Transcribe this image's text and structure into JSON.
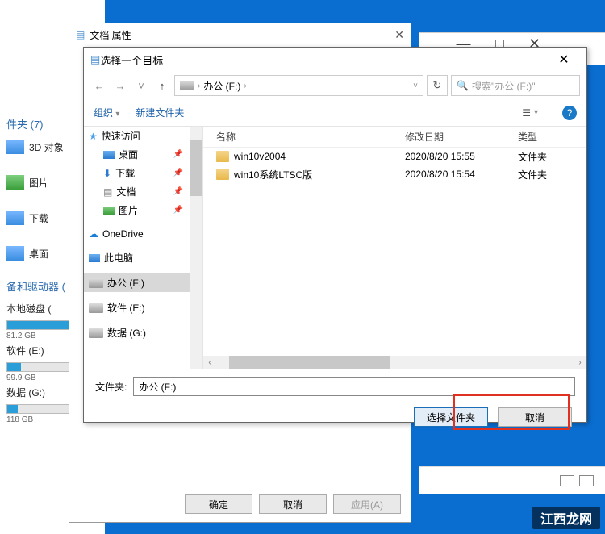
{
  "bg_explorer": {
    "section1": "件夹 (7)",
    "items1": [
      {
        "label": "3D 对象"
      },
      {
        "label": "图片"
      },
      {
        "label": "下载"
      },
      {
        "label": "桌面"
      }
    ],
    "section2": "备和驱动器 (",
    "drives": [
      {
        "label": "本地磁盘 (",
        "cap": "81.2 GB",
        "pct": "90%"
      },
      {
        "label": "软件 (E:)",
        "cap": "99.9 GB",
        "pct": "20%"
      },
      {
        "label": "数据 (G:)",
        "cap": "118 GB",
        "pct": "15%"
      }
    ]
  },
  "bg_window": {
    "min": "—",
    "max": "□",
    "close": "✕"
  },
  "props": {
    "title": "文档 属性",
    "ok": "确定",
    "cancel": "取消",
    "apply": "应用(A)"
  },
  "picker": {
    "title": "选择一个目标",
    "breadcrumb": "办公 (F:)",
    "search_placeholder": "搜索\"办公 (F:)\"",
    "organize": "组织",
    "new_folder": "新建文件夹",
    "columns": {
      "name": "名称",
      "date": "修改日期",
      "type": "类型"
    },
    "nav": {
      "quick": "快速访问",
      "desktop": "桌面",
      "downloads": "下载",
      "documents": "文档",
      "pictures": "图片",
      "onedrive": "OneDrive",
      "thispc": "此电脑",
      "drive_f": "办公 (F:)",
      "drive_e": "软件 (E:)",
      "drive_g": "数据 (G:)"
    },
    "files": [
      {
        "name": "win10v2004",
        "date": "2020/8/20 15:55",
        "type": "文件夹"
      },
      {
        "name": "win10系统LTSC版",
        "date": "2020/8/20 15:54",
        "type": "文件夹"
      }
    ],
    "folder_label": "文件夹:",
    "folder_value": "办公 (F:)",
    "select_btn": "选择文件夹",
    "cancel_btn": "取消"
  },
  "watermark": "江西龙网"
}
